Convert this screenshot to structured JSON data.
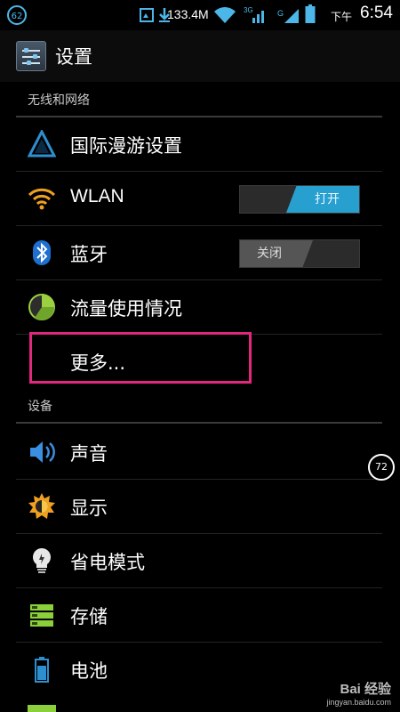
{
  "status_bar": {
    "badge": "62",
    "net_speed": "133.4M",
    "ampm": "下午",
    "time": "6:54",
    "icons": [
      "screenshot-icon",
      "download-icon",
      "wifi-icon",
      "3g-icon",
      "signal-icon",
      "battery-icon"
    ]
  },
  "action_bar": {
    "title": "设置",
    "icon": "settings-sliders-icon"
  },
  "sections": {
    "wireless": "无线和网络",
    "device": "设备"
  },
  "wireless_items": [
    {
      "label": "国际漫游设置",
      "icon": "roaming-triangle-icon"
    },
    {
      "label": "WLAN",
      "icon": "wifi-icon",
      "toggle": "打开"
    },
    {
      "label": "蓝牙",
      "icon": "bluetooth-icon",
      "toggle": "关闭"
    },
    {
      "label": "流量使用情况",
      "icon": "data-usage-icon"
    },
    {
      "label": "更多...",
      "icon": ""
    }
  ],
  "device_items": [
    {
      "label": "声音",
      "icon": "speaker-icon"
    },
    {
      "label": "显示",
      "icon": "brightness-icon"
    },
    {
      "label": "省电模式",
      "icon": "lightbulb-icon"
    },
    {
      "label": "存储",
      "icon": "storage-icon"
    },
    {
      "label": "电池",
      "icon": "battery-icon"
    }
  ],
  "floating_badge": "72",
  "watermark": {
    "main": "Bai 经验",
    "sub": "jingyan.baidu.com"
  },
  "colors": {
    "accent": "#27a0d0",
    "highlight": "#e2277f"
  }
}
